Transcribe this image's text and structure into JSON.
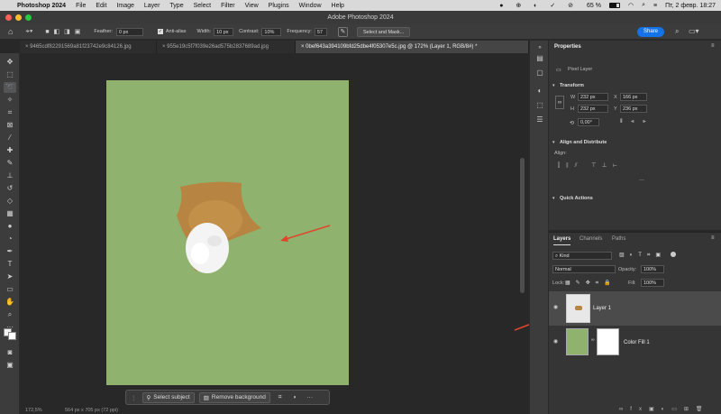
{
  "menubar": {
    "app": "Photoshop 2024",
    "items": [
      "File",
      "Edit",
      "Image",
      "Layer",
      "Type",
      "Select",
      "Filter",
      "View",
      "Plugins",
      "Window",
      "Help"
    ],
    "battery": "65 %",
    "datetime": "Пт, 2 февр.  18:27"
  },
  "window": {
    "title": "Adobe Photoshop 2024"
  },
  "options": {
    "feather_label": "Feather:",
    "feather_value": "0 px",
    "antialias_label": "Anti-alias",
    "width_label": "Width:",
    "width_value": "10 px",
    "contrast_label": "Contrast:",
    "contrast_value": "10%",
    "frequency_label": "Frequency:",
    "frequency_value": "57",
    "select_mask": "Select and Mask...",
    "share": "Share"
  },
  "tabs": [
    "9465cdf82291569a81f23742e9c84126.jpg",
    "955e19c5f7f039e26ad575b2837689ad.jpg",
    "0bef643a394109bfd25dbe4f05307e5c.jpg @ 172% (Layer 1, RGB/8#) *"
  ],
  "context_bar": {
    "select_subject": "Select subject",
    "remove_background": "Remove background"
  },
  "status": {
    "zoom": "172,5%",
    "doc_size": "564 px x 705 px (72 ppi)"
  },
  "properties": {
    "tab": "Properties",
    "kind": "Pixel Layer",
    "transform": "Transform",
    "w": "232 px",
    "h": "232 px",
    "x": "166 px",
    "y": "236 px",
    "angle": "0,00°",
    "align_title": "Align and Distribute",
    "align_label": "Align:",
    "quick_actions": "Quick Actions"
  },
  "layers": {
    "tabs": [
      "Layers",
      "Channels",
      "Paths"
    ],
    "kind": "Kind",
    "blend": "Normal",
    "opacity_label": "Opacity:",
    "opacity": "100%",
    "lock_label": "Lock:",
    "fill_label": "Fill:",
    "fill": "100%",
    "items": [
      {
        "name": "Layer 1"
      },
      {
        "name": "Color Fill 1"
      }
    ]
  },
  "colors": {
    "canvas": "#8fb36f",
    "accent": "#1473e6",
    "arrow": "#e0452b"
  }
}
